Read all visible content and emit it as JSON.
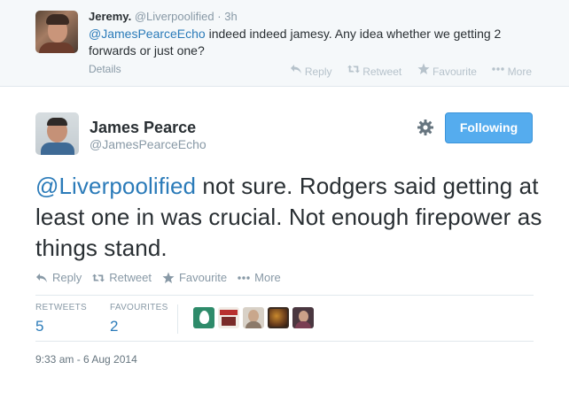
{
  "parent_tweet": {
    "name": "Jeremy.",
    "handle": "@Liverpoolified",
    "separator": "·",
    "time": "3h",
    "mention": "@JamesPearceEcho",
    "text_rest": " indeed indeed jamesy. Any idea whether we getting 2 forwards or just one?",
    "details_label": "Details",
    "actions": {
      "reply": "Reply",
      "retweet": "Retweet",
      "favourite": "Favourite",
      "more": "More"
    }
  },
  "main_tweet": {
    "name": "James Pearce",
    "handle": "@JamesPearceEcho",
    "follow_label": "Following",
    "mention": "@Liverpoolified",
    "text_rest": " not sure. Rodgers said getting at least one in was crucial. Not enough firepower as things stand.",
    "actions": {
      "reply": "Reply",
      "retweet": "Retweet",
      "favourite": "Favourite",
      "more": "More"
    },
    "stats": {
      "retweets_label": "RETWEETS",
      "retweets_value": "5",
      "favourites_label": "FAVOURITES",
      "favourites_value": "2"
    },
    "favouriter_avatars": [
      "egg-avatar",
      "avatar-2",
      "avatar-3",
      "avatar-4",
      "avatar-5"
    ],
    "timestamp": "9:33 am - 6 Aug 2014"
  },
  "colors": {
    "link": "#2b7bb9",
    "follow_button": "#55acee",
    "muted": "#8899a6",
    "parent_bg": "#f5f8fa"
  },
  "icons": [
    "gear-icon",
    "reply-icon",
    "retweet-icon",
    "star-icon",
    "more-icon"
  ]
}
